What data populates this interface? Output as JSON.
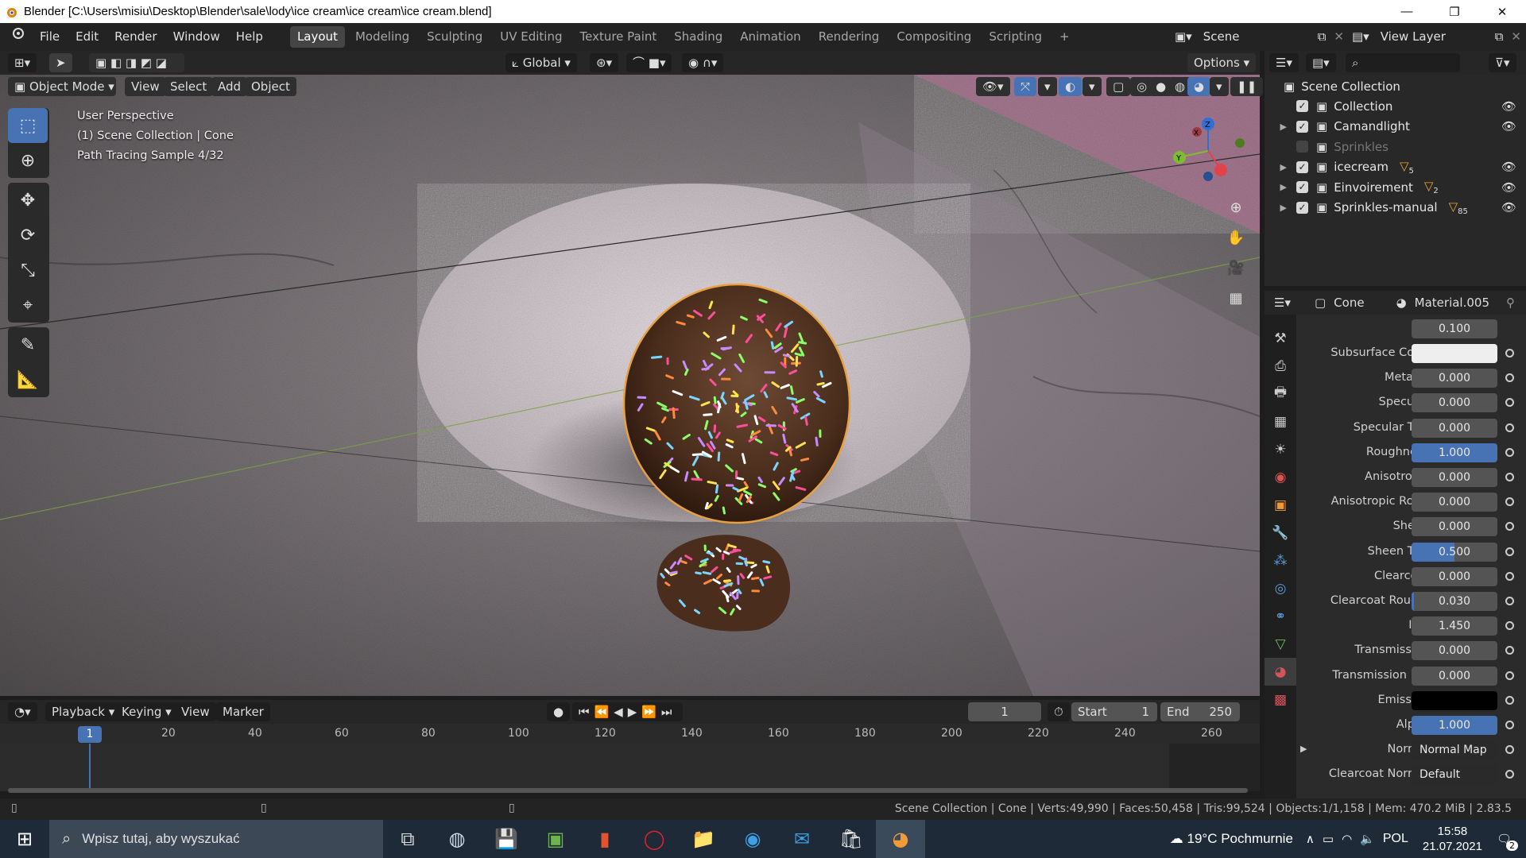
{
  "window": {
    "title": "Blender [C:\\Users\\misiu\\Desktop\\Blender\\sale\\lody\\ice cream\\ice cream\\ice cream.blend]",
    "minimize": "—",
    "maximize": "❐",
    "close": "✕"
  },
  "menu": [
    "File",
    "Edit",
    "Render",
    "Window",
    "Help"
  ],
  "workspaces": [
    "Layout",
    "Modeling",
    "Sculpting",
    "UV Editing",
    "Texture Paint",
    "Shading",
    "Animation",
    "Rendering",
    "Compositing",
    "Scripting",
    "+"
  ],
  "scene": "Scene",
  "view_layer": "View Layer",
  "viewport_header": {
    "transform_orientation": "Global",
    "options": "Options",
    "mode": "Object Mode",
    "view": "View",
    "select": "Select",
    "add": "Add",
    "object": "Object"
  },
  "viewport_overlay": {
    "perspective": "User Perspective",
    "collection": "(1) Scene Collection | Cone",
    "sample": "Path Tracing Sample 4/32"
  },
  "outliner": {
    "root": "Scene Collection",
    "items": [
      {
        "name": "Collection",
        "enabled": true,
        "expand": false,
        "badge": ""
      },
      {
        "name": "Camandlight",
        "enabled": true,
        "expand": true,
        "badge": ""
      },
      {
        "name": "Sprinkles",
        "enabled": false,
        "expand": false,
        "badge": ""
      },
      {
        "name": "icecream",
        "enabled": true,
        "expand": true,
        "badge": "5"
      },
      {
        "name": "Einvoirement",
        "enabled": true,
        "expand": true,
        "badge": "2"
      },
      {
        "name": "Sprinkles-manual",
        "enabled": true,
        "expand": true,
        "badge": "85"
      }
    ]
  },
  "properties": {
    "object": "Cone",
    "material": "Material.005",
    "top_value": "0.100",
    "rows": [
      {
        "label": "Subsurface Color",
        "value": "",
        "kind": "color",
        "color": "#eeeeee"
      },
      {
        "label": "Metallic",
        "value": "0.000",
        "fill": 0
      },
      {
        "label": "Specular",
        "value": "0.000",
        "fill": 0
      },
      {
        "label": "Specular Tint",
        "value": "0.000",
        "fill": 0
      },
      {
        "label": "Roughness",
        "value": "1.000",
        "fill": 1
      },
      {
        "label": "Anisotropic",
        "value": "0.000",
        "fill": 0
      },
      {
        "label": "Anisotropic Rot...",
        "value": "0.000",
        "fill": 0
      },
      {
        "label": "Sheen",
        "value": "0.000",
        "fill": 0
      },
      {
        "label": "Sheen Tint",
        "value": "0.500",
        "fill": 0.5
      },
      {
        "label": "Clearcoat",
        "value": "0.000",
        "fill": 0
      },
      {
        "label": "Clearcoat Roug...",
        "value": "0.030",
        "fill": 0.03
      },
      {
        "label": "IOR",
        "value": "1.450",
        "fill": 0
      },
      {
        "label": "Transmission",
        "value": "0.000",
        "fill": 0
      },
      {
        "label": "Transmission R...",
        "value": "0.000",
        "fill": 0
      },
      {
        "label": "Emission",
        "value": "",
        "kind": "color",
        "color": "#000000"
      },
      {
        "label": "Alpha",
        "value": "1.000",
        "fill": 1
      },
      {
        "label": "Normal",
        "value": "Normal Map",
        "kind": "dark"
      },
      {
        "label": "Clearcoat Normal",
        "value": "Default",
        "kind": "dark"
      }
    ]
  },
  "timeline": {
    "playback": "Playback",
    "keying": "Keying",
    "view": "View",
    "marker": "Marker",
    "current_frame": "1",
    "start_label": "Start",
    "start": "1",
    "end_label": "End",
    "end": "250",
    "ticks": [
      "20",
      "40",
      "60",
      "80",
      "100",
      "120",
      "140",
      "160",
      "180",
      "200",
      "220",
      "240",
      "260"
    ]
  },
  "status": "Scene Collection | Cone | Verts:49,990 | Faces:50,458 | Tris:99,524 | Objects:1/1,158 | Mem: 470.2 MiB | 2.83.5",
  "taskbar": {
    "search_placeholder": "Wpisz tutaj, aby wyszukać",
    "weather": "19°C Pochmurnie",
    "lang": "POL",
    "time": "15:58",
    "date": "21.07.2021",
    "notifications": "2"
  },
  "colors": {
    "accent": "#4772b3",
    "selection": "#f5a232",
    "active_object_outline": "#e8a040"
  }
}
